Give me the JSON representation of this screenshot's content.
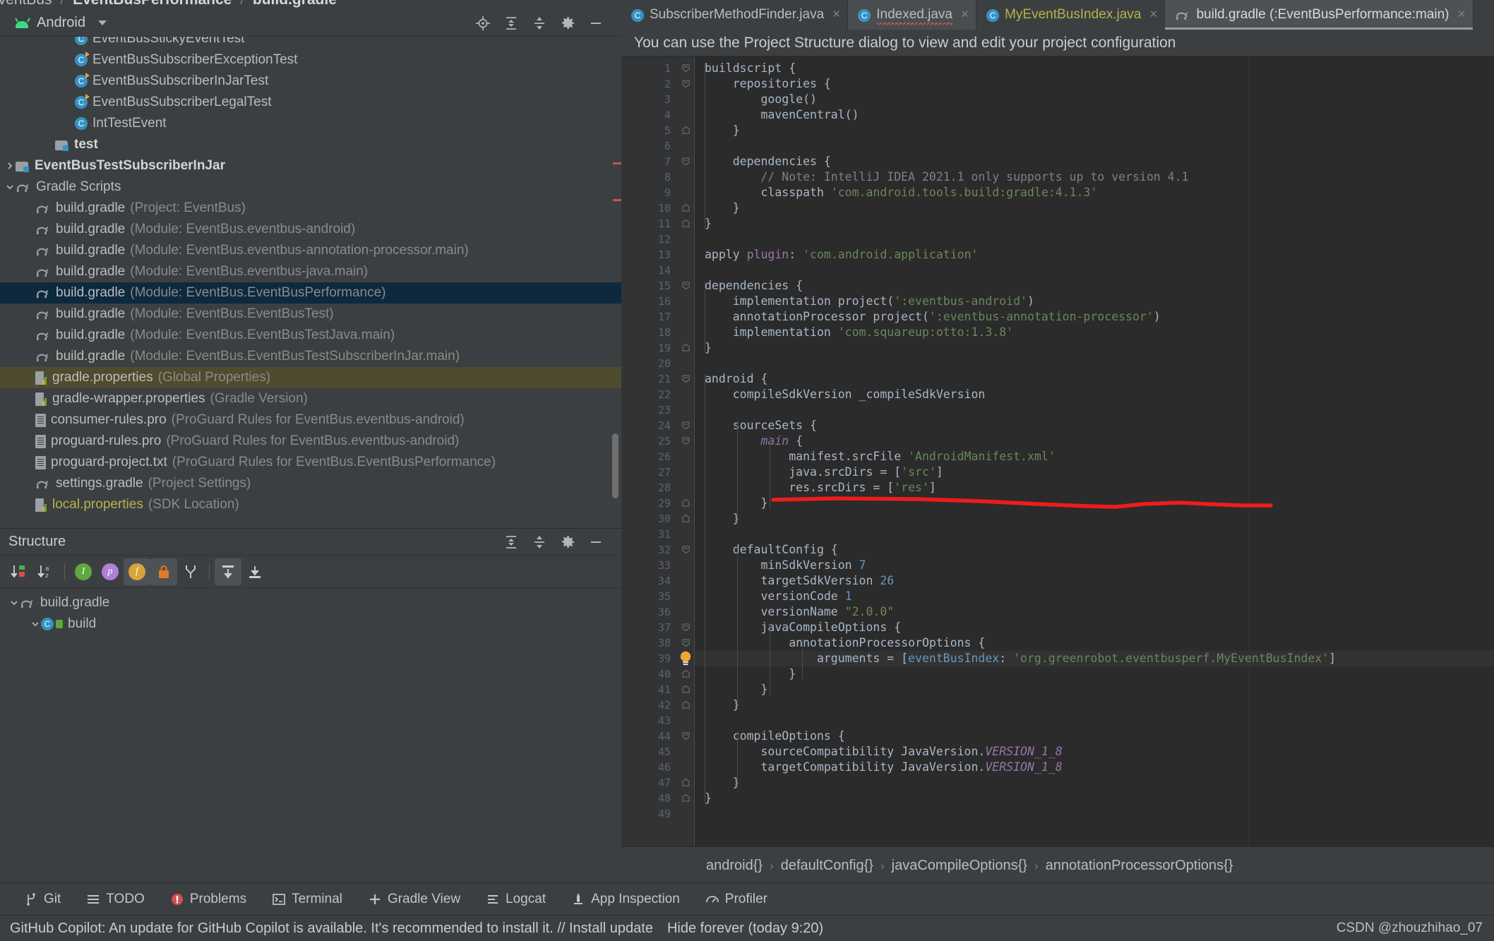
{
  "breadcrumb_top": {
    "parts": [
      "eventBus",
      "EventBusPerformance",
      "build.gradle"
    ],
    "sep": "/"
  },
  "project_panel": {
    "title": "Android",
    "dropdown_icon": "chevron-down-icon",
    "header_icons": [
      "locate-target-icon",
      "expand-all-icon",
      "collapse-all-icon",
      "gear-icon",
      "minimize-icon"
    ],
    "tree": [
      {
        "indent": 3,
        "icon": "class-runnable-icon",
        "label": "EventBusStickyEventTest",
        "hint": "",
        "clipped": true
      },
      {
        "indent": 3,
        "icon": "class-runnable-icon",
        "label": "EventBusSubscriberExceptionTest",
        "hint": ""
      },
      {
        "indent": 3,
        "icon": "class-runnable-icon",
        "label": "EventBusSubscriberInJarTest",
        "hint": ""
      },
      {
        "indent": 3,
        "icon": "class-runnable-icon",
        "label": "EventBusSubscriberLegalTest",
        "hint": ""
      },
      {
        "indent": 3,
        "icon": "class-icon",
        "label": "IntTestEvent",
        "hint": ""
      },
      {
        "indent": 2,
        "icon": "module-folder-icon",
        "label": "test",
        "hint": "",
        "bold": true
      },
      {
        "indent": 0,
        "icon": "module-folder-icon",
        "label": "EventBusTestSubscriberInJar",
        "hint": "",
        "bold": true,
        "arrow": "right"
      },
      {
        "indent": 0,
        "icon": "gradle-icon",
        "label": "Gradle Scripts",
        "hint": "",
        "arrow": "down"
      },
      {
        "indent": 1,
        "icon": "gradle-icon",
        "label": "build.gradle",
        "hint": "(Project: EventBus)"
      },
      {
        "indent": 1,
        "icon": "gradle-icon",
        "label": "build.gradle",
        "hint": "(Module: EventBus.eventbus-android)"
      },
      {
        "indent": 1,
        "icon": "gradle-icon",
        "label": "build.gradle",
        "hint": "(Module: EventBus.eventbus-annotation-processor.main)"
      },
      {
        "indent": 1,
        "icon": "gradle-icon",
        "label": "build.gradle",
        "hint": "(Module: EventBus.eventbus-java.main)"
      },
      {
        "indent": 1,
        "icon": "gradle-icon",
        "label": "build.gradle",
        "hint": "(Module: EventBus.EventBusPerformance)",
        "selected": true
      },
      {
        "indent": 1,
        "icon": "gradle-icon",
        "label": "build.gradle",
        "hint": "(Module: EventBus.EventBusTest)"
      },
      {
        "indent": 1,
        "icon": "gradle-icon",
        "label": "build.gradle",
        "hint": "(Module: EventBus.EventBusTestJava.main)"
      },
      {
        "indent": 1,
        "icon": "gradle-icon",
        "label": "build.gradle",
        "hint": "(Module: EventBus.EventBusTestSubscriberInJar.main)"
      },
      {
        "indent": 1,
        "icon": "properties-icon",
        "label": "gradle.properties",
        "hint": "(Global Properties)",
        "highlight": "olive"
      },
      {
        "indent": 1,
        "icon": "properties-icon",
        "label": "gradle-wrapper.properties",
        "hint": "(Gradle Version)"
      },
      {
        "indent": 1,
        "icon": "text-file-icon",
        "label": "consumer-rules.pro",
        "hint": "(ProGuard Rules for EventBus.eventbus-android)"
      },
      {
        "indent": 1,
        "icon": "text-file-icon",
        "label": "proguard-rules.pro",
        "hint": "(ProGuard Rules for EventBus.eventbus-android)"
      },
      {
        "indent": 1,
        "icon": "text-file-icon",
        "label": "proguard-project.txt",
        "hint": "(ProGuard Rules for EventBus.EventBusPerformance)"
      },
      {
        "indent": 1,
        "icon": "gradle-icon",
        "label": "settings.gradle",
        "hint": "(Project Settings)"
      },
      {
        "indent": 1,
        "icon": "properties-icon",
        "label": "local.properties",
        "hint": "(SDK Location)",
        "label_color": "olive"
      }
    ]
  },
  "structure_panel": {
    "title": "Structure",
    "header_icons": [
      "expand-all-icon",
      "collapse-all-icon",
      "gear-icon",
      "minimize-icon"
    ],
    "toolbar_icons": [
      "sort-by-visibility-icon",
      "sort-alphabetically-icon",
      "show-inherited-icon",
      "show-properties-icon",
      "show-fields-icon",
      "show-non-public-icon",
      "group-icon",
      "scroll-from-source-icon",
      "scroll-to-source-icon"
    ],
    "tree": [
      {
        "indent": 0,
        "icon": "gradle-icon",
        "label": "build.gradle",
        "arrow": "down"
      },
      {
        "indent": 1,
        "icon": "class-lock-icon",
        "label": "build",
        "arrow": "down"
      }
    ]
  },
  "editor": {
    "tabs": [
      {
        "label": "SubscriberMethodFinder.java",
        "icon": "class-icon",
        "state": "normal",
        "closable": true
      },
      {
        "label": "Indexed.java",
        "icon": "class-icon",
        "state": "error-squiggle",
        "closable": true
      },
      {
        "label": "MyEventBusIndex.java",
        "icon": "class-icon",
        "state": "olive",
        "closable": true
      },
      {
        "label": "build.gradle (:EventBusPerformance:main)",
        "icon": "gradle-icon",
        "state": "selected",
        "closable": true
      }
    ],
    "notification": "You can use the Project Structure dialog to view and edit your project configuration",
    "breadcrumb": [
      "android{}",
      "defaultConfig{}",
      "javaCompileOptions{}",
      "annotationProcessorOptions{}"
    ],
    "breadcrumb_sep": "›",
    "lightbulb_line": 39,
    "current_line": 39,
    "lines": [
      {
        "n": 1,
        "tokens": [
          {
            "t": "buildscript {",
            "c": "ident"
          }
        ],
        "fold": "start"
      },
      {
        "n": 2,
        "tokens": [
          {
            "t": "    repositories {",
            "c": "ident"
          }
        ],
        "fold": "start"
      },
      {
        "n": 3,
        "tokens": [
          {
            "t": "        google()",
            "c": "ident"
          }
        ]
      },
      {
        "n": 4,
        "tokens": [
          {
            "t": "        mavenCentral()",
            "c": "ident"
          }
        ]
      },
      {
        "n": 5,
        "tokens": [
          {
            "t": "    }",
            "c": "ident"
          }
        ],
        "fold": "end"
      },
      {
        "n": 6,
        "tokens": []
      },
      {
        "n": 7,
        "tokens": [
          {
            "t": "    dependencies {",
            "c": "ident"
          }
        ],
        "fold": "start"
      },
      {
        "n": 8,
        "tokens": [
          {
            "t": "        // Note: IntelliJ IDEA 2021.1 only supports up to version 4.1",
            "c": "cmt"
          }
        ]
      },
      {
        "n": 9,
        "tokens": [
          {
            "t": "        classpath ",
            "c": "ident"
          },
          {
            "t": "'com.android.tools.build:gradle:4.1.3'",
            "c": "str"
          }
        ]
      },
      {
        "n": 10,
        "tokens": [
          {
            "t": "    }",
            "c": "ident"
          }
        ],
        "fold": "end"
      },
      {
        "n": 11,
        "tokens": [
          {
            "t": "}",
            "c": "ident"
          }
        ],
        "fold": "end"
      },
      {
        "n": 12,
        "tokens": []
      },
      {
        "n": 13,
        "tokens": [
          {
            "t": "apply ",
            "c": "ident"
          },
          {
            "t": "plugin",
            "c": "fld"
          },
          {
            "t": ": ",
            "c": "ident"
          },
          {
            "t": "'com.android.application'",
            "c": "str"
          }
        ]
      },
      {
        "n": 14,
        "tokens": []
      },
      {
        "n": 15,
        "tokens": [
          {
            "t": "dependencies {",
            "c": "ident"
          }
        ],
        "fold": "start"
      },
      {
        "n": 16,
        "tokens": [
          {
            "t": "    implementation project(",
            "c": "ident"
          },
          {
            "t": "':eventbus-android'",
            "c": "str"
          },
          {
            "t": ")",
            "c": "ident"
          }
        ]
      },
      {
        "n": 17,
        "tokens": [
          {
            "t": "    annotationProcessor project(",
            "c": "ident"
          },
          {
            "t": "':eventbus-annotation-processor'",
            "c": "str"
          },
          {
            "t": ")",
            "c": "ident"
          }
        ]
      },
      {
        "n": 18,
        "tokens": [
          {
            "t": "    implementation ",
            "c": "ident"
          },
          {
            "t": "'com.squareup:otto:1.3.8'",
            "c": "str"
          }
        ]
      },
      {
        "n": 19,
        "tokens": [
          {
            "t": "}",
            "c": "ident"
          }
        ],
        "fold": "end"
      },
      {
        "n": 20,
        "tokens": []
      },
      {
        "n": 21,
        "tokens": [
          {
            "t": "android {",
            "c": "ident"
          }
        ],
        "fold": "start"
      },
      {
        "n": 22,
        "tokens": [
          {
            "t": "    compileSdkVersion _compileSdkVersion",
            "c": "ident"
          }
        ]
      },
      {
        "n": 23,
        "tokens": []
      },
      {
        "n": 24,
        "tokens": [
          {
            "t": "    sourceSets {",
            "c": "ident"
          }
        ],
        "fold": "start"
      },
      {
        "n": 25,
        "tokens": [
          {
            "t": "        ",
            "c": "ident"
          },
          {
            "t": "main",
            "c": "prop"
          },
          {
            "t": " {",
            "c": "ident"
          }
        ],
        "fold": "start"
      },
      {
        "n": 26,
        "tokens": [
          {
            "t": "            manifest.srcFile ",
            "c": "ident"
          },
          {
            "t": "'AndroidManifest.xml'",
            "c": "str"
          }
        ]
      },
      {
        "n": 27,
        "tokens": [
          {
            "t": "            java.srcDirs = [",
            "c": "ident"
          },
          {
            "t": "'src'",
            "c": "str"
          },
          {
            "t": "]",
            "c": "ident"
          }
        ]
      },
      {
        "n": 28,
        "tokens": [
          {
            "t": "            res.srcDirs = [",
            "c": "ident"
          },
          {
            "t": "'res'",
            "c": "str"
          },
          {
            "t": "]",
            "c": "ident"
          }
        ]
      },
      {
        "n": 29,
        "tokens": [
          {
            "t": "        }",
            "c": "ident"
          }
        ],
        "fold": "end"
      },
      {
        "n": 30,
        "tokens": [
          {
            "t": "    }",
            "c": "ident"
          }
        ],
        "fold": "end"
      },
      {
        "n": 31,
        "tokens": []
      },
      {
        "n": 32,
        "tokens": [
          {
            "t": "    defaultConfig {",
            "c": "ident"
          }
        ],
        "fold": "start"
      },
      {
        "n": 33,
        "tokens": [
          {
            "t": "        minSdkVersion ",
            "c": "ident"
          },
          {
            "t": "7",
            "c": "num"
          }
        ]
      },
      {
        "n": 34,
        "tokens": [
          {
            "t": "        targetSdkVersion ",
            "c": "ident"
          },
          {
            "t": "26",
            "c": "num"
          }
        ]
      },
      {
        "n": 35,
        "tokens": [
          {
            "t": "        versionCode ",
            "c": "ident"
          },
          {
            "t": "1",
            "c": "num"
          }
        ]
      },
      {
        "n": 36,
        "tokens": [
          {
            "t": "        versionName ",
            "c": "ident"
          },
          {
            "t": "\"2.0.0\"",
            "c": "str"
          }
        ]
      },
      {
        "n": 37,
        "tokens": [
          {
            "t": "        javaCompileOptions {",
            "c": "ident"
          }
        ],
        "fold": "start"
      },
      {
        "n": 38,
        "tokens": [
          {
            "t": "            annotationProcessorOptions {",
            "c": "ident"
          }
        ],
        "fold": "start"
      },
      {
        "n": 39,
        "tokens": [
          {
            "t": "                arguments = [",
            "c": "ident"
          },
          {
            "t": "eventBusIndex",
            "c": "num"
          },
          {
            "t": ": ",
            "c": "ident"
          },
          {
            "t": "'org.greenrobot.eventbusperf.MyEventBusIndex'",
            "c": "str"
          },
          {
            "t": "]",
            "c": "ident"
          }
        ],
        "current": true
      },
      {
        "n": 40,
        "tokens": [
          {
            "t": "            }",
            "c": "ident"
          }
        ],
        "fold": "end"
      },
      {
        "n": 41,
        "tokens": [
          {
            "t": "        }",
            "c": "ident"
          }
        ],
        "fold": "end"
      },
      {
        "n": 42,
        "tokens": [
          {
            "t": "    }",
            "c": "ident"
          }
        ],
        "fold": "end"
      },
      {
        "n": 43,
        "tokens": []
      },
      {
        "n": 44,
        "tokens": [
          {
            "t": "    compileOptions {",
            "c": "ident"
          }
        ],
        "fold": "start"
      },
      {
        "n": 45,
        "tokens": [
          {
            "t": "        sourceCompatibility JavaVersion.",
            "c": "ident"
          },
          {
            "t": "VERSION_1_8",
            "c": "ital"
          }
        ]
      },
      {
        "n": 46,
        "tokens": [
          {
            "t": "        targetCompatibility JavaVersion.",
            "c": "ident"
          },
          {
            "t": "VERSION_1_8",
            "c": "ital"
          }
        ]
      },
      {
        "n": 47,
        "tokens": [
          {
            "t": "    }",
            "c": "ident"
          }
        ],
        "fold": "end"
      },
      {
        "n": 48,
        "tokens": [
          {
            "t": "}",
            "c": "ident"
          }
        ],
        "fold": "end"
      },
      {
        "n": 49,
        "tokens": []
      }
    ],
    "annotation": {
      "type": "red-underline-scribble",
      "color": "#ee1c1c"
    }
  },
  "bottom_toolbar": [
    {
      "label": "Git",
      "icon": "git-branch-icon"
    },
    {
      "label": "TODO",
      "icon": "todo-list-icon"
    },
    {
      "label": "Problems",
      "icon": "problems-error-icon"
    },
    {
      "label": "Terminal",
      "icon": "terminal-icon"
    },
    {
      "label": "Gradle View",
      "icon": "plus-icon"
    },
    {
      "label": "Logcat",
      "icon": "logcat-icon"
    },
    {
      "label": "App Inspection",
      "icon": "app-inspection-icon"
    },
    {
      "label": "Profiler",
      "icon": "profiler-icon"
    }
  ],
  "status_bar": {
    "message": "GitHub Copilot: An update for GitHub Copilot is available. It's recommended to install it. // Install update",
    "hide_link": "Hide forever (today 9:20)",
    "watermark": "CSDN @zhouzhihao_07"
  },
  "colors": {
    "panel_bg": "#3c3f41",
    "editor_bg": "#2b2b2b",
    "gutter_bg": "#313335",
    "selection_blue": "#0d293e",
    "olive_highlight": "#4f4b2f",
    "accent_green": "#3ddc84",
    "annotation_red": "#ee1c1c",
    "string_green": "#6a8759",
    "number_blue": "#6897bb",
    "keyword_orange": "#cc7832",
    "field_purple": "#9876aa"
  }
}
